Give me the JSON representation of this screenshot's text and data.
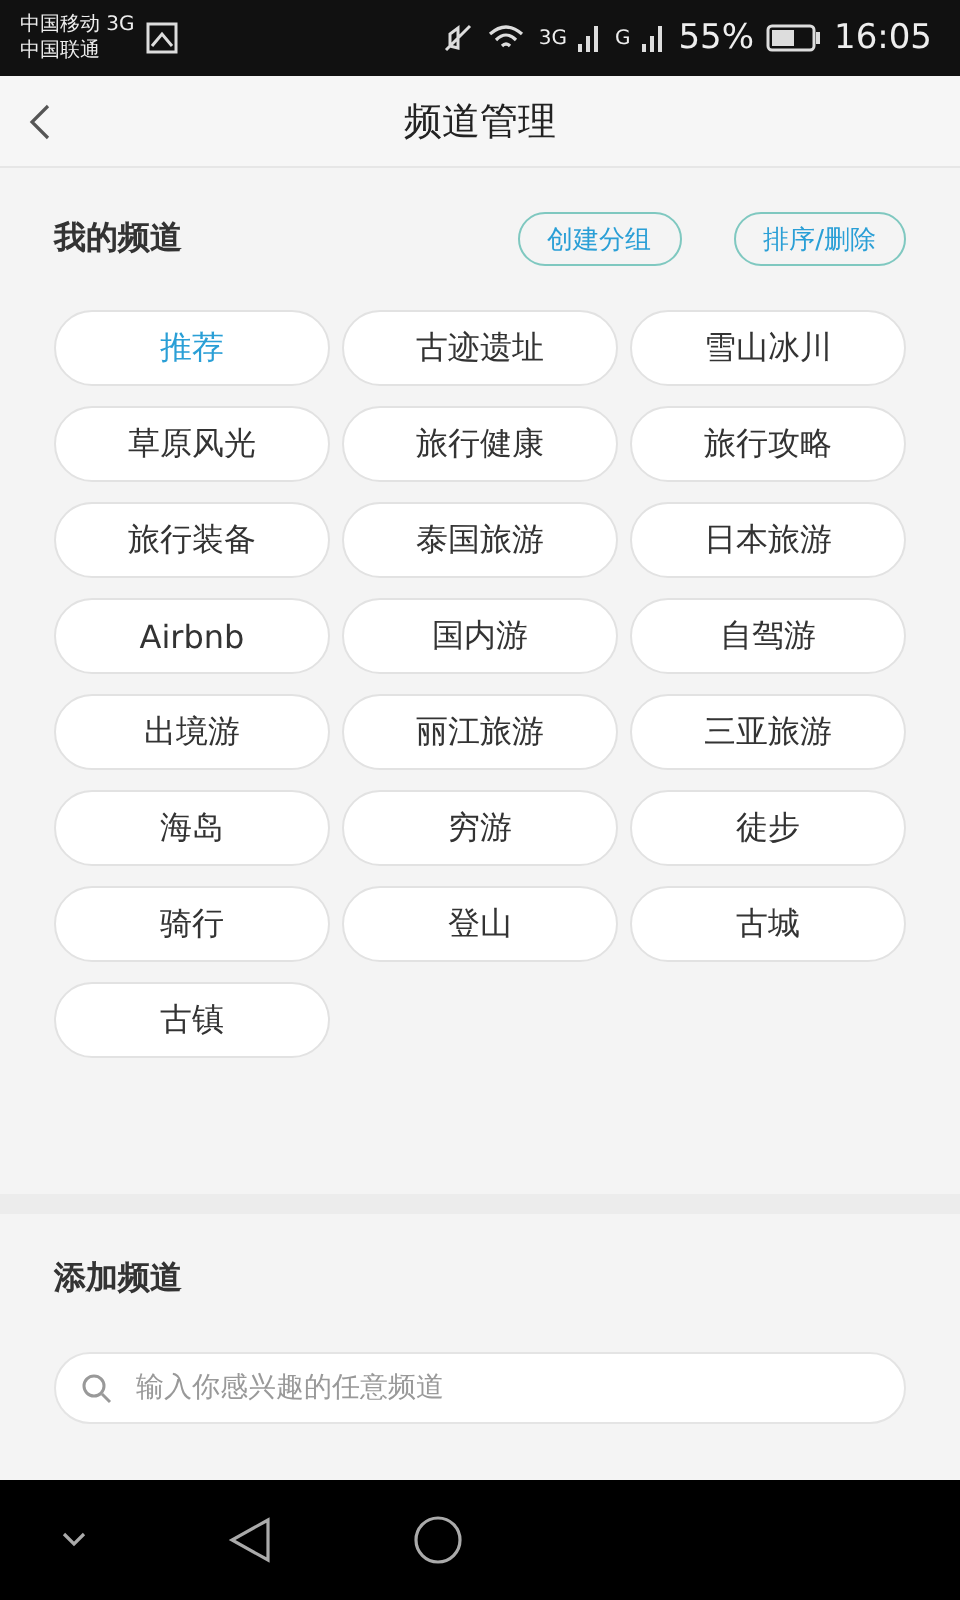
{
  "status_bar": {
    "carrier_1": "中国移动 3G",
    "carrier_2": "中国联通",
    "network_1": "3G",
    "network_2": "G",
    "battery": "55%",
    "time": "16:05"
  },
  "header": {
    "title": "频道管理"
  },
  "my_channels": {
    "title": "我的频道",
    "buttons": [
      "创建分组",
      "排序/删除"
    ],
    "channels": [
      {
        "label": "推荐",
        "selected": true
      },
      {
        "label": "古迹遗址",
        "selected": false
      },
      {
        "label": "雪山冰川",
        "selected": false
      },
      {
        "label": "草原风光",
        "selected": false
      },
      {
        "label": "旅行健康",
        "selected": false
      },
      {
        "label": "旅行攻略",
        "selected": false
      },
      {
        "label": "旅行装备",
        "selected": false
      },
      {
        "label": "泰国旅游",
        "selected": false
      },
      {
        "label": "日本旅游",
        "selected": false
      },
      {
        "label": "Airbnb",
        "selected": false
      },
      {
        "label": "国内游",
        "selected": false
      },
      {
        "label": "自驾游",
        "selected": false
      },
      {
        "label": "出境游",
        "selected": false
      },
      {
        "label": "丽江旅游",
        "selected": false
      },
      {
        "label": "三亚旅游",
        "selected": false
      },
      {
        "label": "海岛",
        "selected": false
      },
      {
        "label": "穷游",
        "selected": false
      },
      {
        "label": "徒步",
        "selected": false
      },
      {
        "label": "骑行",
        "selected": false
      },
      {
        "label": "登山",
        "selected": false
      },
      {
        "label": "古城",
        "selected": false
      },
      {
        "label": "古镇",
        "selected": false
      }
    ]
  },
  "add_channel": {
    "title": "添加频道",
    "search": {
      "placeholder": "输入你感兴趣的任意频道"
    }
  }
}
